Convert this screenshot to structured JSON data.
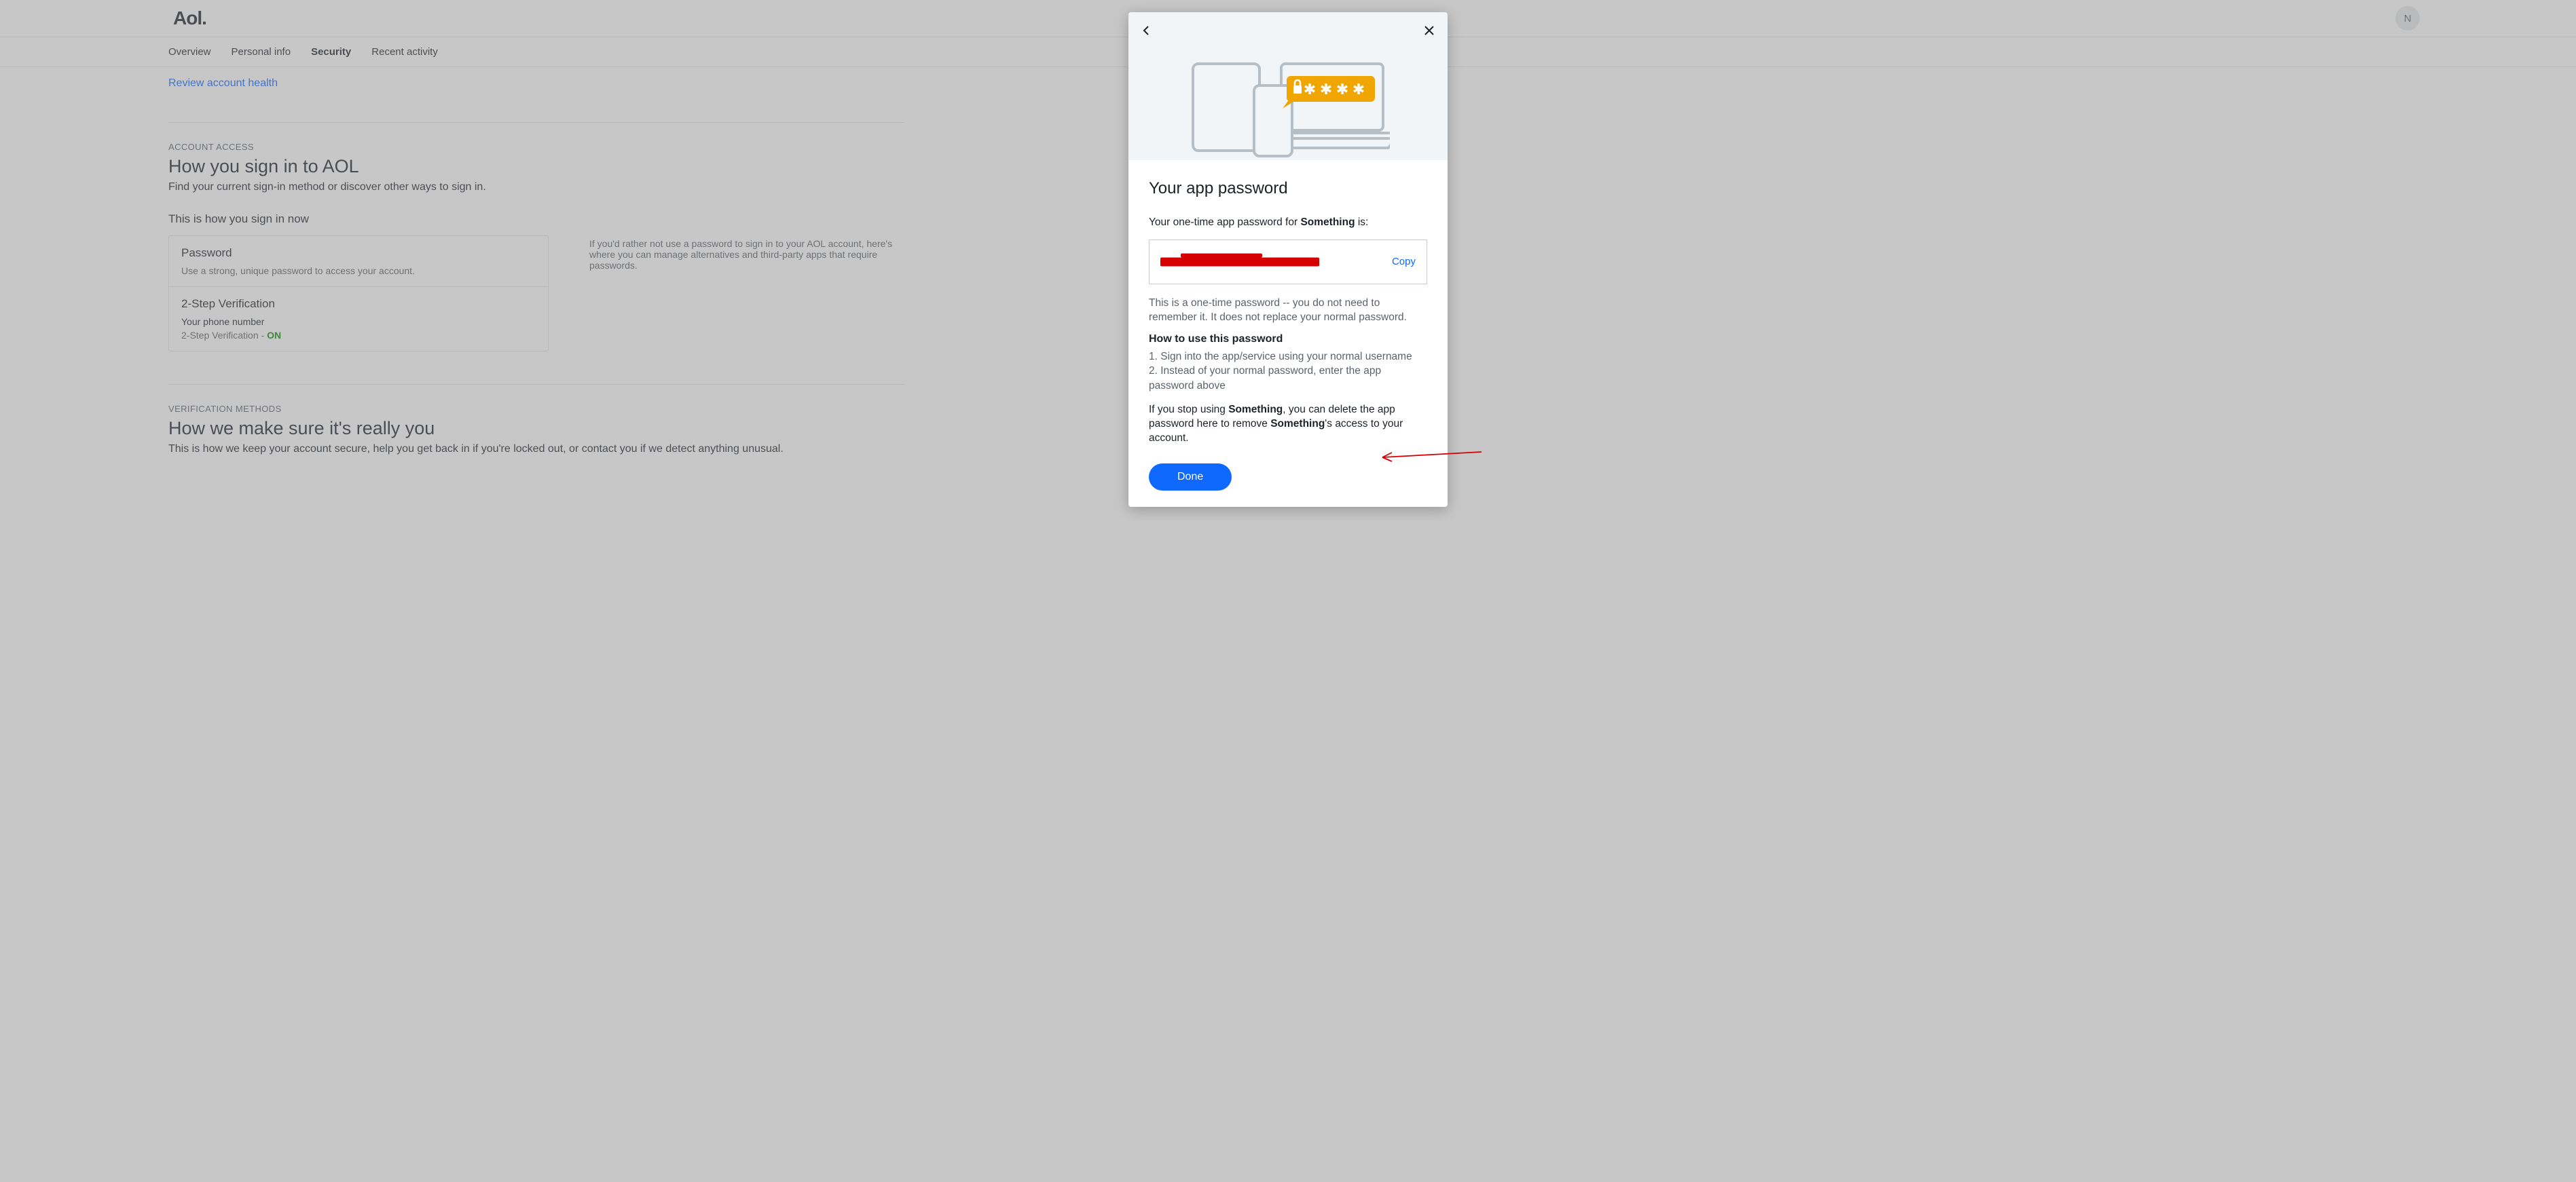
{
  "header": {
    "logo": "Aol.",
    "avatar_initial": "N"
  },
  "tabs": {
    "overview": "Overview",
    "personal": "Personal info",
    "security": "Security",
    "recent": "Recent activity"
  },
  "page": {
    "review_link": "Review account health",
    "access_label": "ACCOUNT ACCESS",
    "access_title": "How you sign in to AOL",
    "access_desc": "Find your current sign-in method or discover other ways to sign in.",
    "signin_now": "This is how you sign in now",
    "password_title": "Password",
    "password_desc": "Use a strong, unique password to access your account.",
    "twostep_title": "2-Step Verification",
    "twostep_phone": "Your phone number",
    "twostep_label": "2-Step Verification - ",
    "twostep_state": "ON",
    "other_ways_side": "If you'd rather not use a password to sign in to your AOL account, here's where you can manage alternatives and third-party apps that require passwords.",
    "verify_label": "VERIFICATION METHODS",
    "verify_title": "How we make sure it's really you",
    "verify_desc": "This is how we keep your account secure, help you get back in if you're locked out, or contact you if we detect anything unusual."
  },
  "modal": {
    "title": "Your app password",
    "intro_a": "Your one-time app password for ",
    "intro_b": "Something",
    "intro_c": " is:",
    "copy": "Copy",
    "note": "This is a one-time password -- you do not need to remember it. It does not replace your normal password.",
    "how_title": "How to use this password",
    "step1": "1. Sign into the app/service using your normal username",
    "step2": "2. Instead of your normal password, enter the app password above",
    "stop_a": "If you stop using ",
    "stop_b": "Something",
    "stop_c": ", you can delete the app password here to remove ",
    "stop_d": "Something",
    "stop_e": "'s access to your account.",
    "done": "Done"
  }
}
